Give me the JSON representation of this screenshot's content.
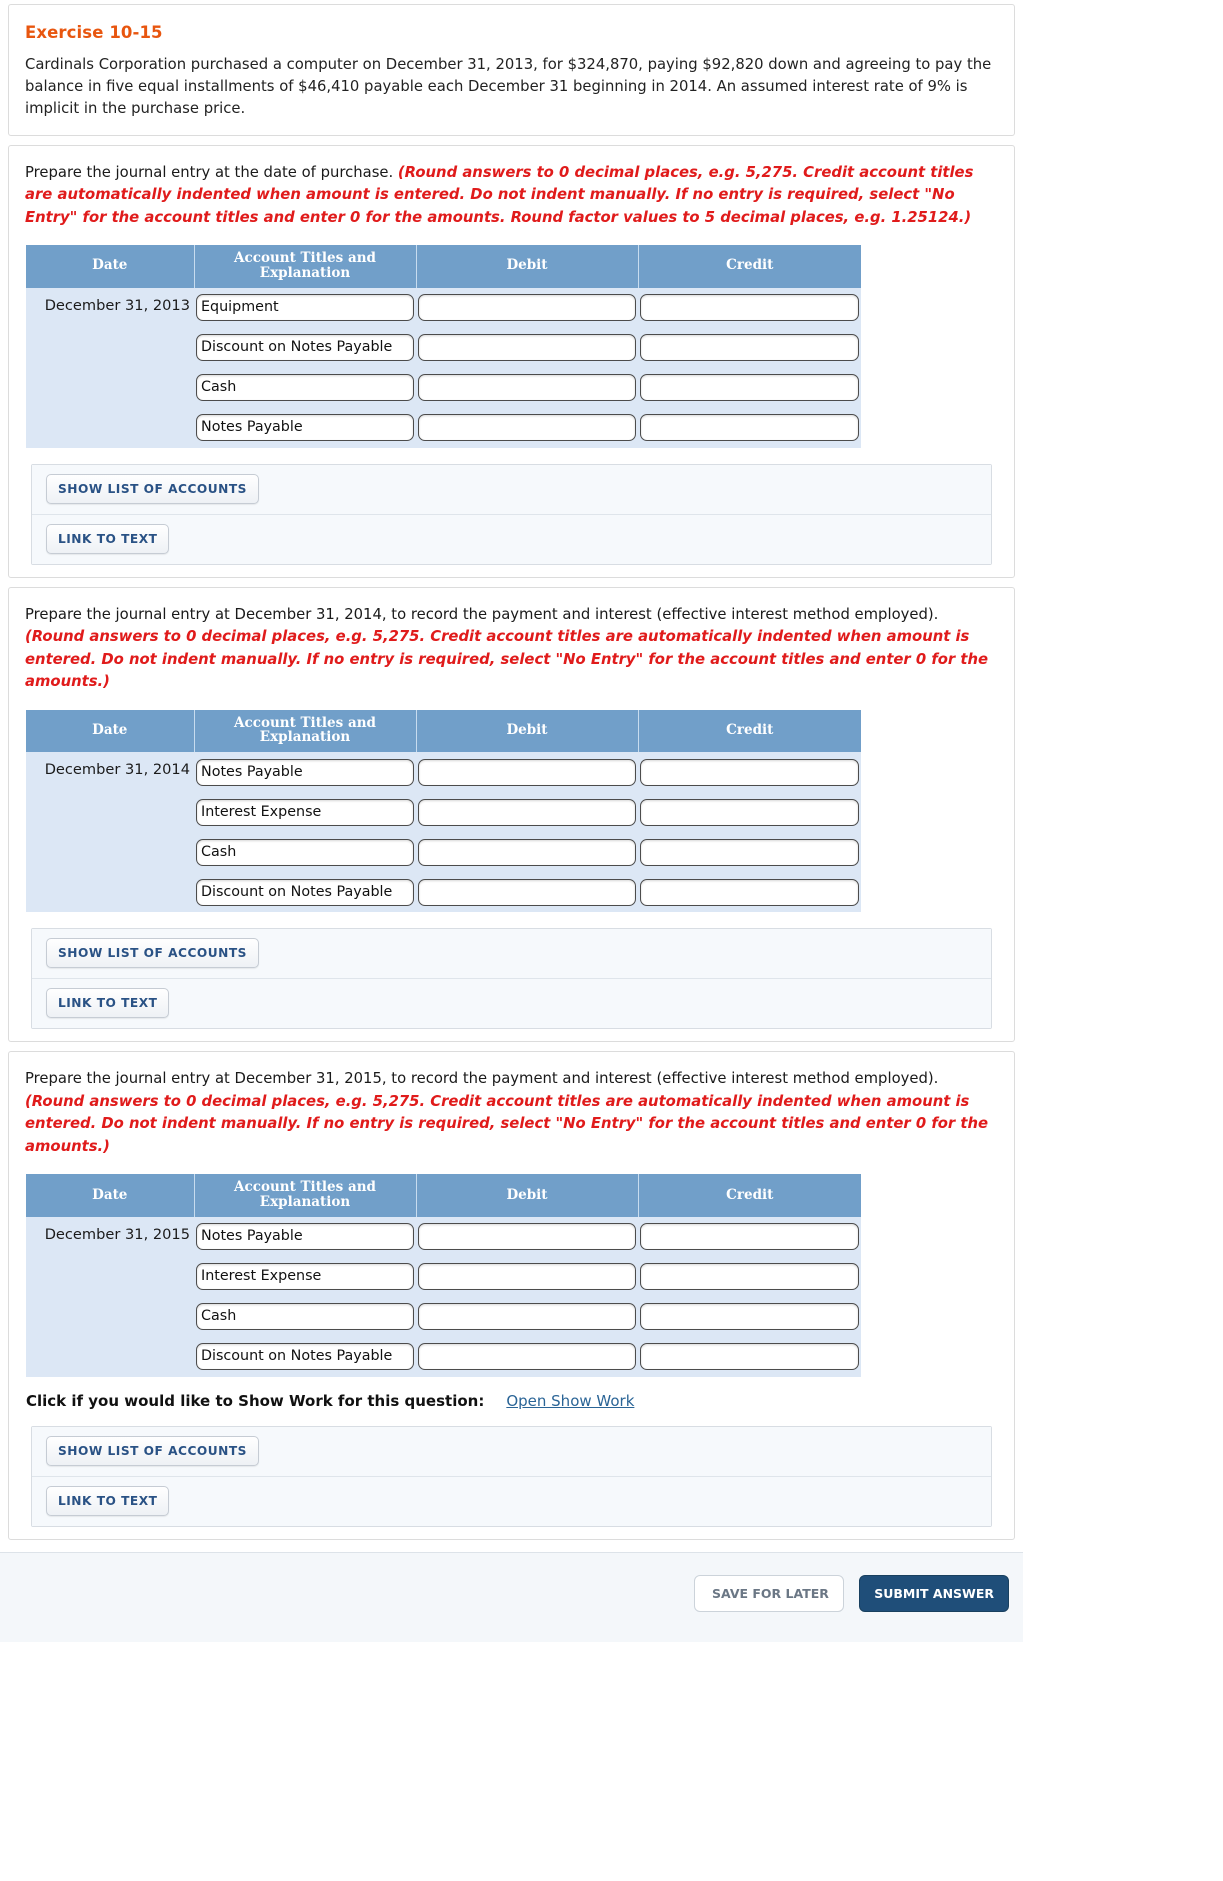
{
  "exercise": {
    "title": "Exercise 10-15",
    "body": "Cardinals Corporation purchased a computer on December 31, 2013, for $324,870, paying $92,820 down and agreeing to pay the balance in five equal installments of $46,410 payable each December 31 beginning in 2014. An assumed interest rate of 9% is implicit in the purchase price."
  },
  "table_headers": {
    "date": "Date",
    "account": "Account Titles and Explanation",
    "debit": "Debit",
    "credit": "Credit"
  },
  "buttons": {
    "show_list_of_accounts": "SHOW LIST OF ACCOUNTS",
    "link_to_text": "LINK TO TEXT"
  },
  "show_work": {
    "label": "Click if you would like to Show Work for this question:",
    "link": "Open Show Work"
  },
  "footer": {
    "secondary_button": "SAVE FOR LATER",
    "primary_button": "SUBMIT ANSWER"
  },
  "colors": {
    "title_orange": "#e8560f",
    "note_red": "#e01b1b",
    "table_header_blue": "#719fc9",
    "table_row_blue": "#dce7f5",
    "button_text_blue": "#2a5285",
    "link_blue": "#2a6496",
    "primary_button_blue": "#1f4e79"
  },
  "parts": [
    {
      "prompt_plain": "Prepare the journal entry at the date of purchase. ",
      "prompt_note": "(Round answers to 0 decimal places, e.g. 5,275. Credit account titles are automatically indented when amount is entered. Do not indent manually. If no entry is required, select \"No Entry\" for the account titles and enter 0 for the amounts. Round factor values to 5 decimal places, e.g. 1.25124.)",
      "date": "December 31, 2013",
      "rows": [
        {
          "account": "Equipment",
          "debit": "",
          "credit": ""
        },
        {
          "account": "Discount on Notes Payable",
          "debit": "",
          "credit": ""
        },
        {
          "account": "Cash",
          "debit": "",
          "credit": ""
        },
        {
          "account": "Notes Payable",
          "debit": "",
          "credit": ""
        }
      ]
    },
    {
      "prompt_plain": "Prepare the journal entry at December 31, 2014, to record the payment and interest (effective interest method employed). ",
      "prompt_note": "(Round answers to 0 decimal places, e.g. 5,275. Credit account titles are automatically indented when amount is entered. Do not indent manually. If no entry is required, select \"No Entry\" for the account titles and enter 0 for the amounts.)",
      "date": "December 31, 2014",
      "rows": [
        {
          "account": "Notes Payable",
          "debit": "",
          "credit": ""
        },
        {
          "account": "Interest Expense",
          "debit": "",
          "credit": ""
        },
        {
          "account": "Cash",
          "debit": "",
          "credit": ""
        },
        {
          "account": "Discount on Notes Payable",
          "debit": "",
          "credit": ""
        }
      ]
    },
    {
      "prompt_plain": "Prepare the journal entry at December 31, 2015, to record the payment and interest (effective interest method employed). ",
      "prompt_note": "(Round answers to 0 decimal places, e.g. 5,275. Credit account titles are automatically indented when amount is entered. Do not indent manually. If no entry is required, select \"No Entry\" for the account titles and enter 0 for the amounts.)",
      "date": "December 31, 2015",
      "rows": [
        {
          "account": "Notes Payable",
          "debit": "",
          "credit": ""
        },
        {
          "account": "Interest Expense",
          "debit": "",
          "credit": ""
        },
        {
          "account": "Cash",
          "debit": "",
          "credit": ""
        },
        {
          "account": "Discount on Notes Payable",
          "debit": "",
          "credit": ""
        }
      ]
    }
  ]
}
